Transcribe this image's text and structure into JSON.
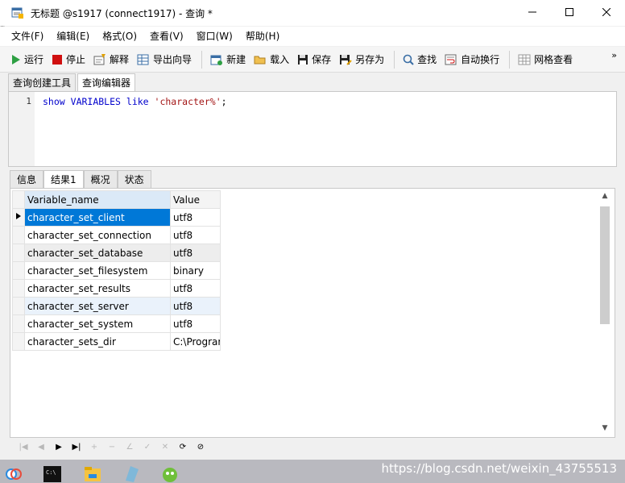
{
  "window": {
    "title": "无标题 @s1917 (connect1917) - 查询 *",
    "minimize_label": "—",
    "maximize_label": "☐",
    "close_label": "✕"
  },
  "menu": [
    "文件(F)",
    "编辑(E)",
    "格式(O)",
    "查看(V)",
    "窗口(W)",
    "帮助(H)"
  ],
  "toolbar": {
    "run": "运行",
    "stop": "停止",
    "explain": "解释",
    "export_wizard": "导出向导",
    "new": "新建",
    "load": "载入",
    "save": "保存",
    "save_as": "另存为",
    "find": "查找",
    "word_wrap": "自动换行",
    "grid_view": "网格查看",
    "more": "»"
  },
  "editor_tabs": [
    "查询创建工具",
    "查询编辑器"
  ],
  "editor": {
    "line_number": "1",
    "kw1": "show",
    "kw2": "VARIABLES",
    "kw3": "like",
    "string": "'character%'",
    "end": ";"
  },
  "result_tabs": [
    "信息",
    "结果1",
    "概况",
    "状态"
  ],
  "grid": {
    "columns": [
      "Variable_name",
      "Value"
    ],
    "rows": [
      {
        "name": "character_set_client",
        "value": "utf8"
      },
      {
        "name": "character_set_connection",
        "value": "utf8"
      },
      {
        "name": "character_set_database",
        "value": "utf8"
      },
      {
        "name": "character_set_filesystem",
        "value": "binary"
      },
      {
        "name": "character_set_results",
        "value": "utf8"
      },
      {
        "name": "character_set_server",
        "value": "utf8"
      },
      {
        "name": "character_set_system",
        "value": "utf8"
      },
      {
        "name": "character_sets_dir",
        "value": "C:\\Program"
      }
    ]
  },
  "taskbar": {
    "watermark": "https://blog.csdn.net/weixin_43755513"
  },
  "colors": {
    "selection": "#0078d7",
    "keyword": "#0000cc",
    "string": "#a31515"
  }
}
